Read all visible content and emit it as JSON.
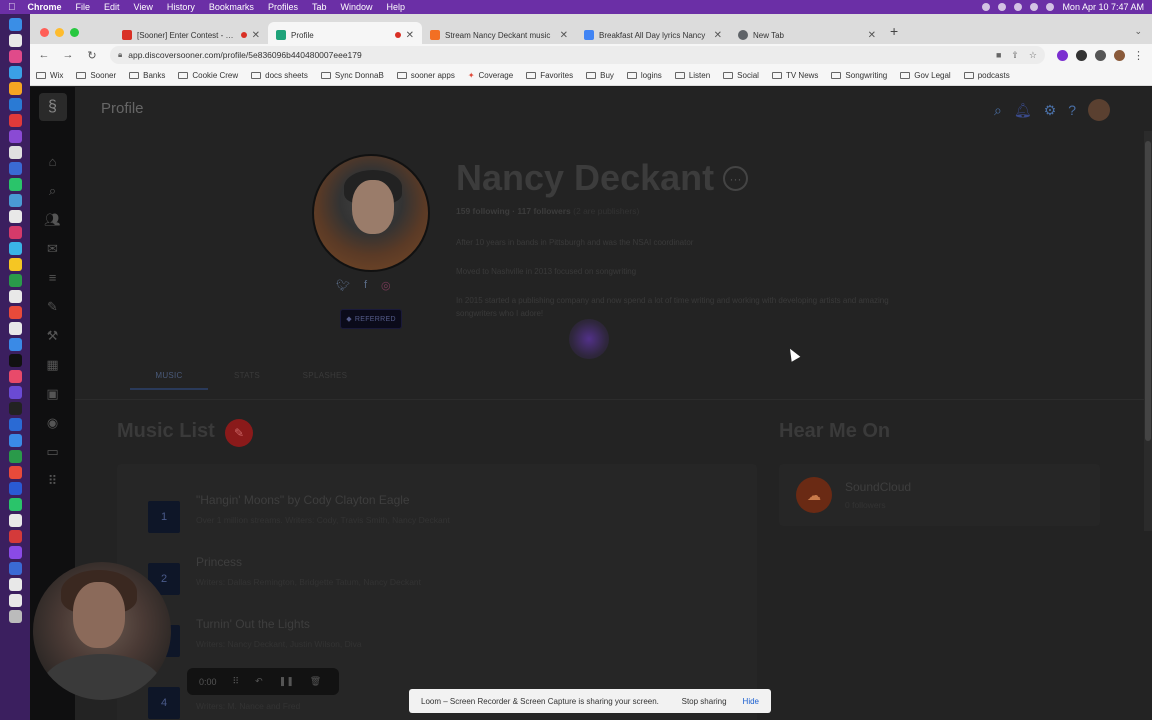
{
  "menubar": {
    "app": "Chrome",
    "items": [
      "File",
      "Edit",
      "View",
      "History",
      "Bookmarks",
      "Profiles",
      "Tab",
      "Window",
      "Help"
    ],
    "clock": "Mon Apr 10  7:47 AM"
  },
  "browser": {
    "tabs": [
      {
        "label": "[Sooner] Enter Contest - new",
        "favicon_color": "#d93025",
        "recording": true
      },
      {
        "label": "Profile",
        "favicon_color": "#1fa37a",
        "recording": true,
        "active": true
      },
      {
        "label": "Stream Nancy Deckant music",
        "favicon_color": "#f26f23",
        "recording": false
      },
      {
        "label": "Breakfast All Day lyrics Nancy",
        "favicon_color": "#4285f4",
        "recording": false
      },
      {
        "label": "New Tab",
        "favicon_color": "#5f6368",
        "recording": false
      }
    ],
    "url": "app.discoversooner.com/profile/5e836096b440480007eee179",
    "bookmarks": [
      {
        "label": "Wix",
        "folder": true
      },
      {
        "label": "Sooner",
        "folder": true
      },
      {
        "label": "Banks",
        "folder": true
      },
      {
        "label": "Cookie Crew",
        "folder": true
      },
      {
        "label": "docs sheets",
        "folder": true
      },
      {
        "label": "Sync DonnaB",
        "folder": true
      },
      {
        "label": "sooner apps",
        "folder": true
      },
      {
        "label": "Coverage",
        "folder": false
      },
      {
        "label": "Favorites",
        "folder": true
      },
      {
        "label": "Buy",
        "folder": true
      },
      {
        "label": "logins",
        "folder": true
      },
      {
        "label": "Listen",
        "folder": true
      },
      {
        "label": "Social",
        "folder": true
      },
      {
        "label": "TV News",
        "folder": true
      },
      {
        "label": "Songwriting",
        "folder": true
      },
      {
        "label": "Gov Legal",
        "folder": true
      },
      {
        "label": "podcasts",
        "folder": true
      }
    ]
  },
  "app": {
    "page_title": "Profile",
    "profile": {
      "name": "Nancy Deckant",
      "stats": "159 following · 117 followers",
      "stats_sub": "(2 are publishers)",
      "bio": [
        "After 10 years in bands in Pittsburgh and was the NSAI coordinator",
        "Moved to Nashville in 2013 focused on songwriting",
        "In 2015 started a publishing company and now spend a lot of time writing and working with developing artists and amazing songwriters who I adore!"
      ],
      "referred_label": "REFERRED"
    },
    "tabs": [
      "MUSIC",
      "STATS",
      "SPLASHES"
    ],
    "music_list": {
      "title": "Music List",
      "items": [
        {
          "num": "1",
          "title": "\"Hangin' Moons\" by Cody Clayton Eagle",
          "sub": "Over 1 million streams. Writers: Cody, Travis Smith, Nancy Deckant"
        },
        {
          "num": "2",
          "title": "Princess",
          "sub": "Writers: Dallas Remington, Bridgette Tatum, Nancy Deckant"
        },
        {
          "num": "3",
          "title": "Turnin' Out the Lights",
          "sub": "Writers: Nancy Deckant, Justin Wilson, Diva"
        },
        {
          "num": "4",
          "title": "",
          "sub": "Writers: M. Nance and Fred"
        }
      ]
    },
    "hear_me_on": {
      "title": "Hear Me On",
      "platform": "SoundCloud",
      "followers": "0 followers"
    }
  },
  "loom": {
    "timer": "0:00",
    "share_message": "Loom – Screen Recorder & Screen Capture is sharing your screen.",
    "stop_label": "Stop sharing",
    "hide_label": "Hide"
  }
}
